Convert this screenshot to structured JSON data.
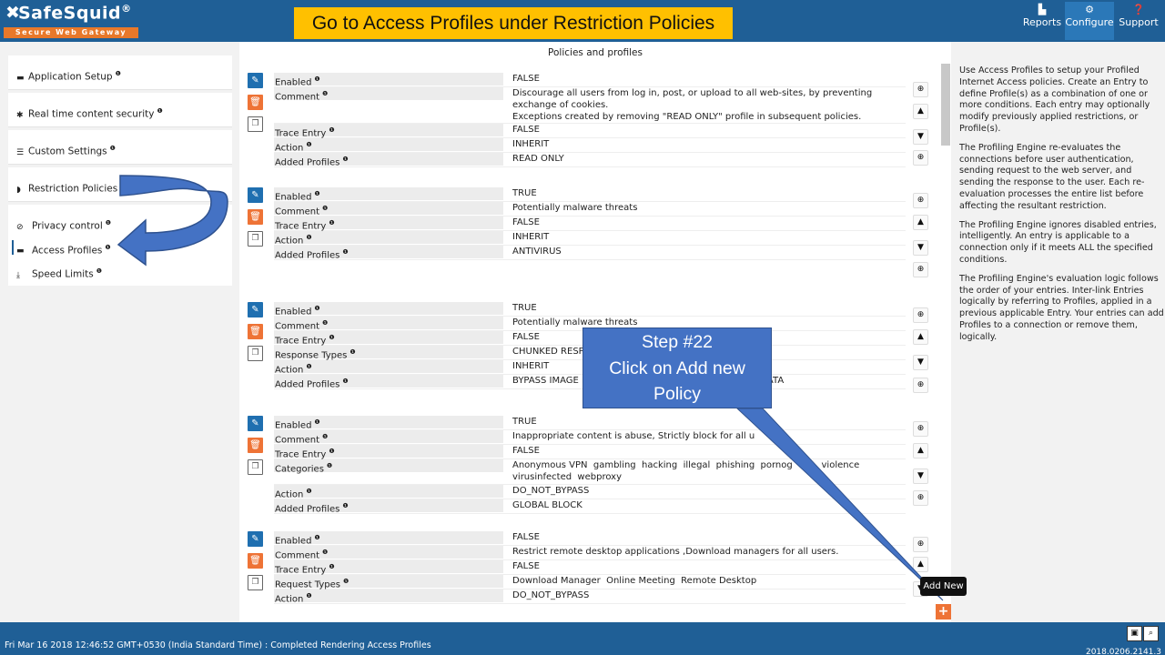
{
  "app": {
    "logo_name": "SafeSquid",
    "logo_reg": "®",
    "logo_tagline": "Secure Web Gateway",
    "banner": "Go to Access Profiles under Restriction Policies"
  },
  "nav": [
    {
      "label": "Reports",
      "icon": "bar-chart-icon"
    },
    {
      "label": "Configure",
      "icon": "gears-icon"
    },
    {
      "label": "Support",
      "icon": "question-icon"
    }
  ],
  "sidebar": {
    "items": [
      {
        "label": "Application Setup",
        "icon": "briefcase-icon"
      },
      {
        "label": "Real time content security",
        "icon": "bug-icon"
      },
      {
        "label": "Custom Settings",
        "icon": "sliders-icon"
      },
      {
        "label": "Restriction Policies",
        "icon": "shield-icon"
      }
    ],
    "subitems": [
      {
        "label": "Privacy control",
        "icon": "ban-icon"
      },
      {
        "label": "Access Profiles",
        "icon": "briefcase-icon"
      },
      {
        "label": "Speed Limits",
        "icon": "download-icon"
      }
    ]
  },
  "main": {
    "title": "Policies and profiles",
    "policies": [
      {
        "rows": [
          {
            "label": "Enabled",
            "value": "FALSE"
          },
          {
            "label": "Comment",
            "value": "Discourage all users from log in, post, or upload to all web-sites, by preventing exchange of cookies.\nExceptions created by removing \"READ ONLY\" profile in subsequent policies."
          },
          {
            "label": "Trace Entry",
            "value": "FALSE"
          },
          {
            "label": "Action",
            "value": "INHERIT"
          },
          {
            "label": "Added Profiles",
            "value": "READ ONLY"
          }
        ]
      },
      {
        "rows": [
          {
            "label": "Enabled",
            "value": "TRUE"
          },
          {
            "label": "Comment",
            "value": "Potentially malware threats"
          },
          {
            "label": "Trace Entry",
            "value": "FALSE"
          },
          {
            "label": "Action",
            "value": "INHERIT"
          },
          {
            "label": "Added Profiles",
            "value": "ANTIVIRUS"
          }
        ]
      },
      {
        "rows": [
          {
            "label": "Enabled",
            "value": "TRUE"
          },
          {
            "label": "Comment",
            "value": "Potentially malware threats"
          },
          {
            "label": "Trace Entry",
            "value": "FALSE"
          },
          {
            "label": "Response Types",
            "value": "CHUNKED RESPO"
          },
          {
            "label": "Action",
            "value": "INHERIT"
          },
          {
            "label": "Added Profiles",
            "value": "BYPASS IMAGE FI                                      N  CHUNKED DATA"
          }
        ]
      },
      {
        "rows": [
          {
            "label": "Enabled",
            "value": "TRUE"
          },
          {
            "label": "Comment",
            "value": "Inappropriate content is abuse, Strictly block for all u"
          },
          {
            "label": "Trace Entry",
            "value": "FALSE"
          },
          {
            "label": "Categories",
            "value": "Anonymous VPN  gambling  hacking  illegal  phishing  pornog          violence\nvirusinfected  webproxy"
          },
          {
            "label": "Action",
            "value": "DO_NOT_BYPASS"
          },
          {
            "label": "Added Profiles",
            "value": "GLOBAL BLOCK"
          }
        ]
      },
      {
        "rows": [
          {
            "label": "Enabled",
            "value": "FALSE"
          },
          {
            "label": "Comment",
            "value": "Restrict remote desktop applications ,Download managers for all users."
          },
          {
            "label": "Trace Entry",
            "value": "FALSE"
          },
          {
            "label": "Request Types",
            "value": "Download Manager  Online Meeting  Remote Desktop"
          },
          {
            "label": "Action",
            "value": "DO_NOT_BYPASS"
          }
        ]
      }
    ]
  },
  "help": [
    "Use Access Profiles to setup your Profiled Internet Access policies. Create an Entry to define Profile(s) as a combination of one or more conditions. Each entry may optionally modify previously applied restrictions, or Profile(s).",
    "The Profiling Engine re-evaluates the connections before user authentication, sending request to the web server, and sending the response to the user. Each re-evaluation processes the entire list before affecting the resultant restriction.",
    "The Profiling Engine ignores disabled entries, intelligently. An entry is applicable to a connection only if it meets ALL the specified conditions.",
    "The Profiling Engine's evaluation logic follows the order of your entries. Inter-link Entries logically by referring to Profiles, applied in a previous applicable Entry. Your entries can add Profiles to a connection or remove them, logically."
  ],
  "callout": {
    "line1": "Step #22",
    "line2": "Click on Add new",
    "line3": "Policy"
  },
  "add_new_tooltip": "Add New",
  "footer": {
    "status": "Fri Mar 16 2018 12:46:52 GMT+0530 (India Standard Time) : Completed Rendering Access Profiles",
    "version": "2018.0206.2141.3"
  },
  "colors": {
    "header": "#1f5f96",
    "banner": "#ffc000",
    "callout": "#4472c4",
    "accent_orange": "#ee7336"
  }
}
